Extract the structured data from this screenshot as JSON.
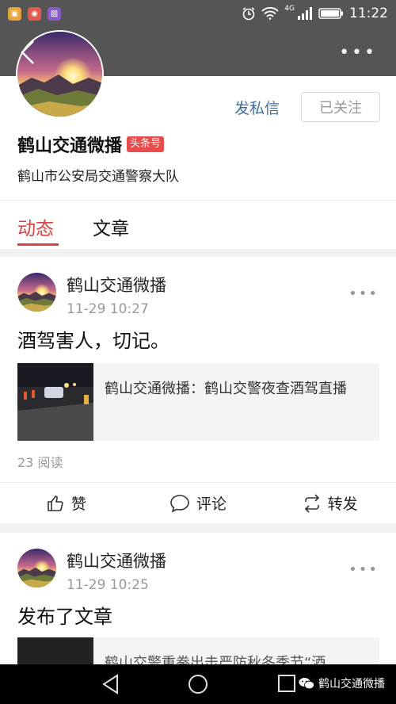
{
  "status_bar": {
    "time": "11:22",
    "network": "4G",
    "icons": [
      "app-icon-1",
      "app-icon-2",
      "app-icon-3",
      "alarm-icon",
      "wifi-icon",
      "signal-icon",
      "battery-icon"
    ]
  },
  "profile": {
    "name": "鹤山交通微播",
    "badge": "头条号",
    "description": "鹤山市公安局交通警察大队",
    "message_label": "发私信",
    "follow_label": "已关注"
  },
  "tabs": [
    {
      "label": "动态",
      "active": true
    },
    {
      "label": "文章",
      "active": false
    }
  ],
  "posts": [
    {
      "author": "鹤山交通微播",
      "time": "11-29 10:27",
      "text": "酒驾害人，切记。",
      "link_title": "鹤山交通微播：鹤山交警夜查酒驾直播",
      "reads": "23 阅读",
      "actions": {
        "like": "赞",
        "comment": "评论",
        "share": "转发"
      }
    },
    {
      "author": "鹤山交通微播",
      "time": "11-29 10:25",
      "text": "发布了文章",
      "link_title": "鹤山交警重拳出击严防秋冬季节“酒"
    }
  ],
  "watermark": "鹤山交通微播",
  "colors": {
    "accent": "#d9423f",
    "link": "#3f6d9e",
    "badge": "#e94c4c"
  }
}
